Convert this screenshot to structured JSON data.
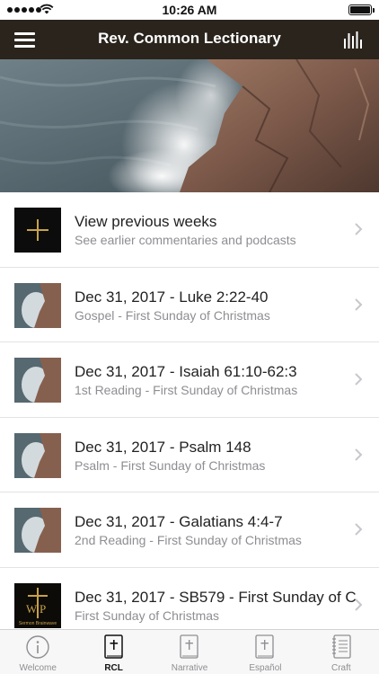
{
  "status_bar": {
    "time": "10:26 AM"
  },
  "nav": {
    "title": "Rev. Common Lectionary"
  },
  "list": {
    "rows": [
      {
        "title": "View previous weeks",
        "subtitle": "See earlier commentaries and podcasts",
        "thumb": "plus-icon"
      },
      {
        "title": "Dec 31, 2017 - Luke 2:22-40",
        "subtitle": "Gospel - First Sunday of Christmas",
        "thumb": "wave-thumbnail"
      },
      {
        "title": "Dec 31, 2017 - Isaiah 61:10-62:3",
        "subtitle": "1st Reading - First Sunday of Christmas",
        "thumb": "wave-thumbnail"
      },
      {
        "title": "Dec 31, 2017 - Psalm 148",
        "subtitle": "Psalm - First Sunday of Christmas",
        "thumb": "wave-thumbnail"
      },
      {
        "title": "Dec 31, 2017 - Galatians 4:4-7",
        "subtitle": "2nd Reading - First Sunday of Christmas",
        "thumb": "wave-thumbnail"
      },
      {
        "title": "Dec 31, 2017 - SB579 - First Sunday of C",
        "subtitle": "First Sunday of Christmas",
        "thumb": "sermon-brainwave-logo"
      }
    ]
  },
  "sermon_logo_text": "Sermon Brainwave",
  "tabs": [
    {
      "label": "Welcome",
      "icon": "info-icon",
      "active": false
    },
    {
      "label": "RCL",
      "icon": "bible-icon",
      "active": true
    },
    {
      "label": "Narrative",
      "icon": "bible-icon",
      "active": false
    },
    {
      "label": "Español",
      "icon": "bible-icon",
      "active": false
    },
    {
      "label": "Craft",
      "icon": "notebook-icon",
      "active": false
    }
  ],
  "colors": {
    "nav_bg": "#2a241c",
    "accent_gold": "#c8a24a",
    "subtitle_gray": "#8e8e93"
  }
}
